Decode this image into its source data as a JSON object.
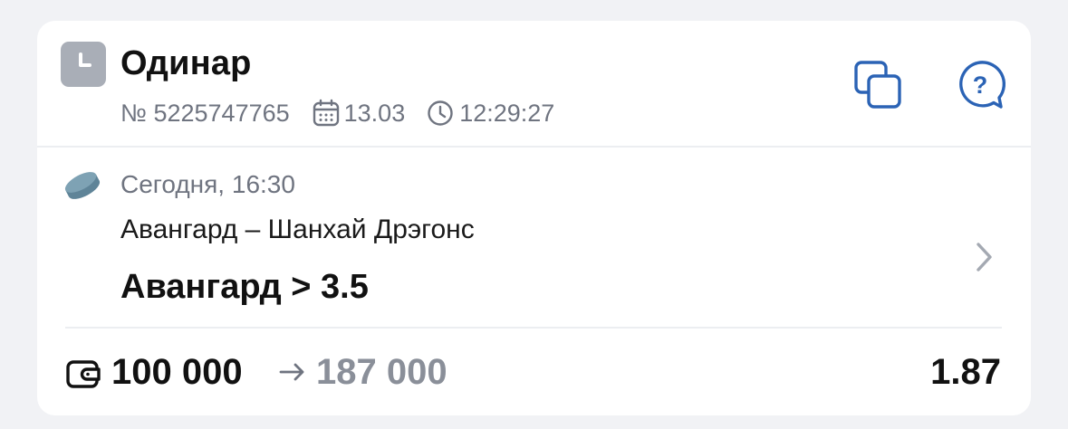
{
  "bet": {
    "type": "Одинар",
    "number": "№ 5225747765",
    "date": "13.03",
    "time": "12:29:27"
  },
  "event": {
    "start": "Сегодня, 16:30",
    "teams": "Авангард – Шанхай Дрэгонс",
    "pick": "Авангард > 3.5"
  },
  "footer": {
    "stake": "100 000",
    "payout": "187 000",
    "odds": "1.87"
  },
  "icons": {
    "status": "clock-icon",
    "date": "calendar-icon",
    "time": "clock-icon",
    "copy": "copy-icon",
    "help": "help-chat-icon",
    "sport": "hockey-puck-icon",
    "nav": "chevron-right-icon",
    "wallet": "wallet-icon",
    "arrow": "arrow-right-icon"
  },
  "colors": {
    "accent": "#2b63b5",
    "muted_text": "#6f7480",
    "status_badge": "#a9aeb7",
    "puck": "#6f93a6"
  }
}
